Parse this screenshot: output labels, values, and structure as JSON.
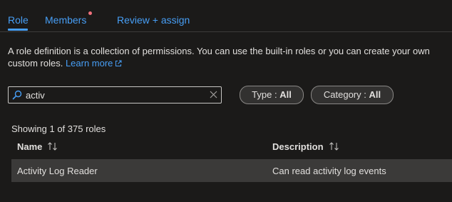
{
  "tabs": {
    "role": "Role",
    "members": "Members",
    "review": "Review + assign"
  },
  "description": {
    "text": "A role definition is a collection of permissions. You can use the built-in roles or you can create your own custom roles.",
    "link": "Learn more"
  },
  "search": {
    "value": "activ"
  },
  "filters": {
    "type_label": "Type : ",
    "type_value": "All",
    "category_label": "Category : ",
    "category_value": "All"
  },
  "results": {
    "showing": "Showing 1 of 375 roles"
  },
  "table": {
    "columns": [
      "Name",
      "Description"
    ],
    "rows": [
      {
        "name": "Activity Log Reader",
        "description": "Can read activity log events"
      }
    ]
  },
  "colors": {
    "background": "#1b1a19",
    "accent": "#479ef5",
    "notification_dot": "#f1707b",
    "row_selected": "#3b3a39"
  },
  "icons": {
    "search": "search-icon",
    "clear": "close-icon",
    "external": "external-link-icon",
    "sort": "sort-icon"
  }
}
